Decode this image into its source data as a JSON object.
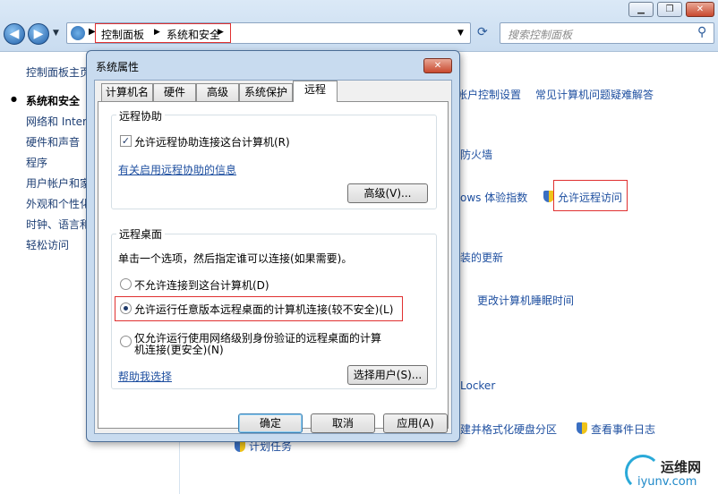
{
  "window": {
    "minimize": "▁",
    "maximize": "❐",
    "close": "✕"
  },
  "address": {
    "crumbs": [
      "控制面板",
      "系统和安全"
    ],
    "search_placeholder": "搜索控制面板"
  },
  "leftnav": {
    "items": [
      "控制面板主页",
      "系统和安全",
      "网络和 Internet",
      "硬件和声音",
      "程序",
      "用户帐户和家庭安全",
      "外观和个性化",
      "时钟、语言和区域",
      "轻松访问"
    ]
  },
  "main": {
    "links": {
      "uac": "更改用户帐户控制设置",
      "troubleshoot": "常见计算机问题疑难解答",
      "firewall": "防火墙",
      "wei": "ows 体验指数",
      "remote": "允许远程访问",
      "updates": "装的更新",
      "sleep": "更改计算机睡眠时间",
      "bitlocker": "Locker",
      "partition": "建并格式化硬盘分区",
      "events": "查看事件日志",
      "tasks": "计划任务"
    }
  },
  "dialog": {
    "title": "系统属性",
    "close": "✕",
    "tabs": [
      "计算机名",
      "硬件",
      "高级",
      "系统保护",
      "远程"
    ],
    "assist": {
      "title": "远程协助",
      "checkbox_label": "允许远程协助连接这台计算机(R)",
      "info_link": "有关启用远程协助的信息",
      "advanced_button": "高级(V)..."
    },
    "desktop": {
      "title": "远程桌面",
      "instruction": "单击一个选项，然后指定谁可以连接(如果需要)。",
      "option1": "不允许连接到这台计算机(D)",
      "option2": "允许运行任意版本远程桌面的计算机连接(较不安全)(L)",
      "option3_line1": "仅允许运行使用网络级别身份验证的远程桌面的计算",
      "option3_line2": "机连接(更安全)(N)",
      "help_link": "帮助我选择",
      "select_users": "选择用户(S)..."
    },
    "buttons": {
      "ok": "确定",
      "cancel": "取消",
      "apply": "应用(A)"
    }
  },
  "watermark": {
    "name": "运维网",
    "url": "iyunv.com"
  }
}
